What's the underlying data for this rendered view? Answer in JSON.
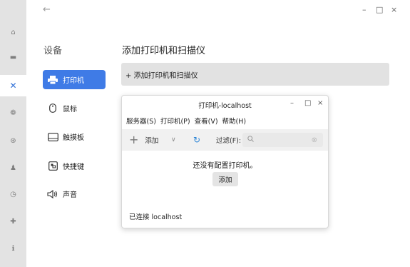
{
  "rail": {
    "icons": [
      {
        "name": "home-icon",
        "glyph": "⌂"
      },
      {
        "name": "display-icon",
        "glyph": "▬"
      },
      {
        "name": "devices-icon",
        "glyph": "✕",
        "active": true
      },
      {
        "name": "personalization-icon",
        "glyph": "❁"
      },
      {
        "name": "network-icon",
        "glyph": "⊛"
      },
      {
        "name": "accounts-icon",
        "glyph": "♟"
      },
      {
        "name": "datetime-icon",
        "glyph": "◷"
      },
      {
        "name": "update-icon",
        "glyph": "✚"
      },
      {
        "name": "info-icon",
        "glyph": "ℹ"
      }
    ]
  },
  "window": {
    "back": "←",
    "minimize": "–",
    "maximize": "□",
    "close": "×"
  },
  "nav": {
    "title": "设备",
    "items": [
      {
        "label": "打印机",
        "icon": "printer-icon",
        "glyph": "🖶",
        "active": true
      },
      {
        "label": "鼠标",
        "icon": "mouse-icon",
        "glyph": "🖱"
      },
      {
        "label": "触摸板",
        "icon": "touchpad-icon",
        "glyph": "▭"
      },
      {
        "label": "快捷键",
        "icon": "shortcut-icon",
        "glyph": "⌨"
      },
      {
        "label": "声音",
        "icon": "sound-icon",
        "glyph": "🔊"
      }
    ]
  },
  "main": {
    "title": "添加打印机和扫描仪",
    "add_label": "+ 添加打印机和扫描仪"
  },
  "dialog": {
    "title": "打印机-localhost",
    "minimize": "–",
    "maximize": "□",
    "close": "×",
    "menus": [
      "服务器(S)",
      "打印机(P)",
      "查看(V)",
      "帮助(H)"
    ],
    "toolbar": {
      "add_label": "添加",
      "filter_label": "过滤(F):",
      "search_placeholder": ""
    },
    "empty_message": "还没有配置打印机。",
    "add_button": "添加",
    "status": "已连接 localhost"
  },
  "colors": {
    "accent": "#3f7be6",
    "rail_bg": "#e3e3e3"
  }
}
